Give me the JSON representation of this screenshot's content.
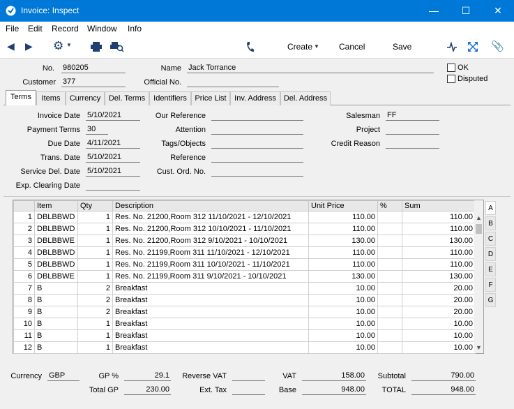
{
  "window": {
    "title": "Invoice: Inspect",
    "minimize": "—",
    "maximize": "☐",
    "close": "✕"
  },
  "menu": [
    "File",
    "Edit",
    "Record",
    "Window",
    "Info"
  ],
  "toolbar": {
    "create": "Create",
    "cancel": "Cancel",
    "save": "Save"
  },
  "header": {
    "no_label": "No.",
    "no": "980205",
    "name_label": "Name",
    "name": "Jack Torrance",
    "customer_label": "Customer",
    "customer": "377",
    "official_label": "Official No.",
    "official": "",
    "ok_label": "OK",
    "disputed_label": "Disputed"
  },
  "tabs": [
    "Terms",
    "Items",
    "Currency",
    "Del. Terms",
    "Identifiers",
    "Price List",
    "Inv. Address",
    "Del. Address"
  ],
  "terms": {
    "invoice_date_label": "Invoice Date",
    "invoice_date": "5/10/2021",
    "payment_terms_label": "Payment Terms",
    "payment_terms": "30",
    "due_date_label": "Due Date",
    "due_date": "4/11/2021",
    "trans_date_label": "Trans. Date",
    "trans_date": "5/10/2021",
    "service_del_label": "Service Del. Date",
    "service_del": "5/10/2021",
    "exp_clearing_label": "Exp. Clearing Date",
    "exp_clearing": "",
    "our_ref_label": "Our Reference",
    "attention_label": "Attention",
    "tags_label": "Tags/Objects",
    "reference_label": "Reference",
    "cust_ord_label": "Cust. Ord. No.",
    "salesman_label": "Salesman",
    "salesman": "FF",
    "project_label": "Project",
    "credit_reason_label": "Credit Reason"
  },
  "grid": {
    "headers": [
      "",
      "Item",
      "Qty",
      "Description",
      "Unit Price",
      "%",
      "Sum"
    ],
    "rows": [
      [
        "1",
        "DBLBBWD",
        "1",
        "Res. No. 21200,Room 312 11/10/2021 - 12/10/2021",
        "110.00",
        "",
        "110.00"
      ],
      [
        "2",
        "DBLBBWD",
        "1",
        "Res. No. 21200,Room 312 10/10/2021 - 11/10/2021",
        "110.00",
        "",
        "110.00"
      ],
      [
        "3",
        "DBLBBWE",
        "1",
        "Res. No. 21200,Room 312 9/10/2021 - 10/10/2021",
        "130.00",
        "",
        "130.00"
      ],
      [
        "4",
        "DBLBBWD",
        "1",
        "Res. No. 21199,Room 311 11/10/2021 - 12/10/2021",
        "110.00",
        "",
        "110.00"
      ],
      [
        "5",
        "DBLBBWD",
        "1",
        "Res. No. 21199,Room 311 10/10/2021 - 11/10/2021",
        "110.00",
        "",
        "110.00"
      ],
      [
        "6",
        "DBLBBWE",
        "1",
        "Res. No. 21199,Room 311 9/10/2021 - 10/10/2021",
        "130.00",
        "",
        "130.00"
      ],
      [
        "7",
        "B",
        "2",
        "Breakfast",
        "10.00",
        "",
        "20.00"
      ],
      [
        "8",
        "B",
        "2",
        "Breakfast",
        "10.00",
        "",
        "20.00"
      ],
      [
        "9",
        "B",
        "2",
        "Breakfast",
        "10.00",
        "",
        "20.00"
      ],
      [
        "10",
        "B",
        "1",
        "Breakfast",
        "10.00",
        "",
        "10.00"
      ],
      [
        "11",
        "B",
        "1",
        "Breakfast",
        "10.00",
        "",
        "10.00"
      ],
      [
        "12",
        "B",
        "1",
        "Breakfast",
        "10.00",
        "",
        "10.00"
      ]
    ],
    "side_tabs": [
      "A",
      "B",
      "C",
      "D",
      "E",
      "F",
      "G"
    ]
  },
  "footer": {
    "currency_label": "Currency",
    "currency": "GBP",
    "gp_pct_label": "GP %",
    "gp_pct": "29.1",
    "total_gp_label": "Total GP",
    "total_gp": "230.00",
    "reverse_vat_label": "Reverse VAT",
    "reverse_vat": "",
    "ext_tax_label": "Ext. Tax",
    "ext_tax": "",
    "vat_label": "VAT",
    "vat": "158.00",
    "base_label": "Base",
    "base": "948.00",
    "subtotal_label": "Subtotal",
    "subtotal": "790.00",
    "total_label": "TOTAL",
    "total": "948.00"
  }
}
